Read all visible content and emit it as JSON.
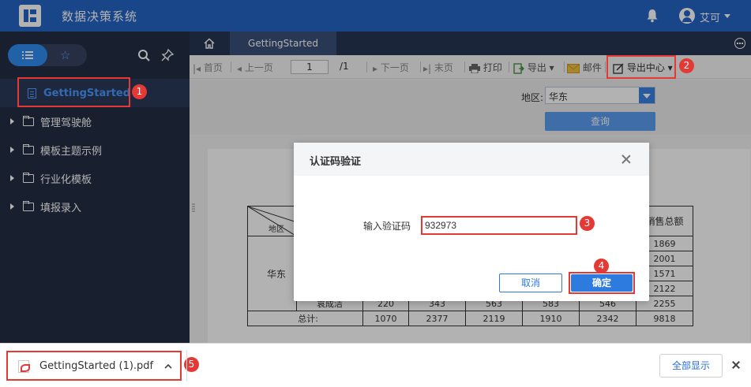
{
  "app": {
    "title": "数据决策系统",
    "user_name": "艾可"
  },
  "sidebar": {
    "active_item": "GettingStarted",
    "items": [
      {
        "label": "管理驾驶舱"
      },
      {
        "label": "模板主题示例"
      },
      {
        "label": "行业化模板"
      },
      {
        "label": "填报录入"
      }
    ]
  },
  "tabs": {
    "active": "GettingStarted"
  },
  "toolbar": {
    "first": "首页",
    "prev": "上一页",
    "page": "1",
    "total": "/1",
    "next": "下一页",
    "last": "末页",
    "print": "打印",
    "export": "导出",
    "mail": "邮件",
    "export_center": "导出中心"
  },
  "params": {
    "region_label": "地区:",
    "region_value": "华东",
    "query": "查询"
  },
  "report": {
    "corner_label": "地区",
    "last_col_header": "销售总额",
    "region": "华东",
    "last_col_values": [
      "1869",
      "2001",
      "1571",
      "2122"
    ],
    "row": {
      "name": "袁成洁",
      "values": [
        "220",
        "343",
        "563",
        "583",
        "546",
        "2255"
      ]
    },
    "total": {
      "label": "总计:",
      "values": [
        "1070",
        "2377",
        "2119",
        "1910",
        "2342",
        "9818"
      ]
    }
  },
  "modal": {
    "title": "认证码验证",
    "input_label": "输入验证码",
    "input_value": "932973",
    "cancel": "取消",
    "ok": "确定"
  },
  "download": {
    "file_name": "GettingStarted (1).pdf",
    "show_all": "全部显示"
  },
  "annotations": [
    "1",
    "2",
    "3",
    "4",
    "5"
  ],
  "colors": {
    "topbar": "#2563c4",
    "sidebar": "#232e45",
    "accent": "#2e7be0",
    "highlight": "#e53935"
  }
}
